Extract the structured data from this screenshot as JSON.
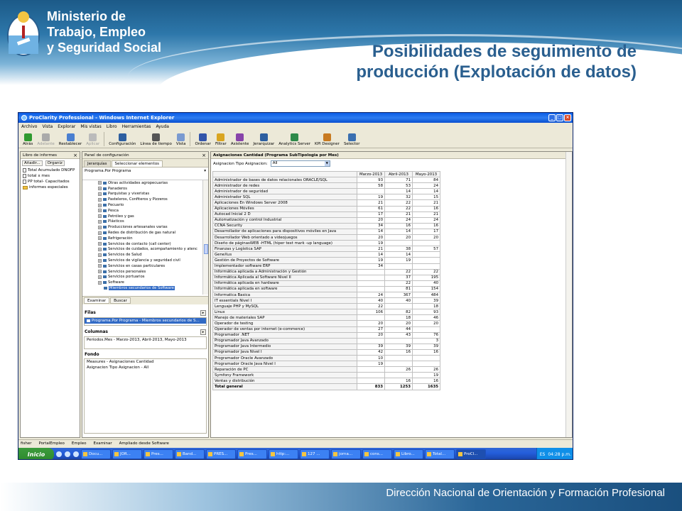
{
  "slide": {
    "ministry_lines": [
      "Ministerio de",
      "Trabajo, Empleo",
      "y Seguridad Social"
    ],
    "title_lines": [
      "Posibilidades de seguimiento de",
      "producción (Explotación de datos)"
    ],
    "footer": "Dirección Nacional de Orientación y Formación Profesional"
  },
  "window": {
    "title": "ProClarity Professional - Windows Internet Explorer",
    "menu": [
      "Archivo",
      "Vista",
      "Explorar",
      "Mis vistas",
      "Libro",
      "Herramientas",
      "Ayuda"
    ],
    "toolbar": [
      {
        "label": "Atrás",
        "icon": "back-icon",
        "color": "#2f9a2f",
        "disabled": false
      },
      {
        "label": "Adelante",
        "icon": "forward-icon",
        "color": "#aaaaaa",
        "disabled": true
      },
      {
        "label": "Restablecer",
        "icon": "reset-icon",
        "color": "#4a7fd0",
        "disabled": false
      },
      {
        "label": "Aplicar",
        "icon": "apply-icon",
        "color": "#bbbbbb",
        "disabled": true
      },
      {
        "label": "Configuración",
        "icon": "layout-icon",
        "color": "#2d5fa0",
        "disabled": false
      },
      {
        "label": "Línea de tiempo",
        "icon": "timeline-icon",
        "color": "#555555",
        "disabled": false
      },
      {
        "label": "Vista",
        "icon": "chart-icon",
        "color": "#7a9ad0",
        "disabled": false
      },
      {
        "label": "Ordenar",
        "icon": "sort-icon",
        "color": "#3355aa",
        "disabled": false
      },
      {
        "label": "Filtrar",
        "icon": "filter-icon",
        "color": "#d9a520",
        "disabled": false
      },
      {
        "label": "Asistente",
        "icon": "wizard-icon",
        "color": "#8844aa",
        "disabled": false
      },
      {
        "label": "Jerarquizar",
        "icon": "hierarchy-icon",
        "color": "#2d5fa0",
        "disabled": false
      },
      {
        "label": "Analytics Server",
        "icon": "server-icon",
        "color": "#2f8a4a",
        "disabled": false
      },
      {
        "label": "KPI Designer",
        "icon": "kpi-icon",
        "color": "#c87a20",
        "disabled": false
      },
      {
        "label": "Selector",
        "icon": "selector-icon",
        "color": "#3a6fb0",
        "disabled": false
      }
    ],
    "libro": {
      "header": "Libro de informes",
      "add_label": "Añadir...",
      "organize_label": "Organiz",
      "items": [
        {
          "label": "Total Acumulado DNOFP",
          "icon": "doc"
        },
        {
          "label": "total x mes",
          "icon": "doc"
        },
        {
          "label": "PP total- Capacitados",
          "icon": "doc"
        },
        {
          "label": "informes especiales",
          "icon": "folder"
        }
      ]
    },
    "config": {
      "header": "Panel de configuración",
      "tabs": [
        "Jerarquías",
        "Seleccionar elementos"
      ],
      "program_label": "Programa.Por Programa",
      "tree": [
        "Otras actividades agropecuarias",
        "Panaderos",
        "Parquistas y viveristas",
        "Pasteleros, Confiteros y Pizzeros",
        "Pecuario",
        "Pesca",
        "Petróleo y gas",
        "Plásticos",
        "Producciones artesanales varias",
        "Redes de distribución de gas natural",
        "Refrigeración",
        "Servicios de contacto (call center)",
        "Servicios de cuidados, acompañamiento y atenc",
        "Servicios de Salud",
        "Servicios de vigilancia y seguridad civil",
        "Servicios en casas particulares",
        "Servicios personales",
        "Servicios portuarios",
        "Software"
      ],
      "tree_selected": "Miembros secundarios de Software",
      "bottom_tabs": [
        "Examinar",
        "Buscar"
      ],
      "filas_label": "Filas",
      "filas_value": "Programa.Por Programa - Miembros secundarios de S...",
      "columnas_label": "Columnas",
      "columnas_value": "Periodos.Mes - Marzo-2013, Abril-2013, Mayo-2013",
      "fondo_label": "Fondo",
      "fondo_values": [
        "Measures - Asignaciones Cantidad",
        "Asignacion Tipo Asignacion - All"
      ]
    },
    "grid": {
      "title": "Asignaciones Cantidad (Programa SubTipologia por Mes)",
      "filter_label": "Asignacion Tipo Asignacion:",
      "filter_value": "All",
      "columns": [
        "Marzo-2013",
        "Abril-2013",
        "Mayo-2013"
      ],
      "rows": [
        [
          "Administrador de bases de datos relacionales ORACLE/SQL",
          "93",
          "71",
          "84"
        ],
        [
          "Administrador de redes",
          "58",
          "53",
          "24"
        ],
        [
          "Administrador de seguridad",
          "",
          "14",
          "14"
        ],
        [
          "Administrador SQL",
          "19",
          "32",
          "15"
        ],
        [
          "Aplicaciones En Windows Server 2008",
          "21",
          "22",
          "21"
        ],
        [
          "Aplicaciones Móviles",
          "61",
          "22",
          "16"
        ],
        [
          "Autocad Inicial 2 D",
          "17",
          "21",
          "21"
        ],
        [
          "Automatización y control Industrial",
          "20",
          "24",
          "24"
        ],
        [
          "CCNA Security",
          "34",
          "16",
          "16"
        ],
        [
          "Desarrollador de aplicaciones para dispositivos móviles en Java",
          "14",
          "14",
          "17"
        ],
        [
          "Desarrollador Web orientado a videojuegos",
          "20",
          "20",
          "20"
        ],
        [
          "Diseño de páginasWEB -HTML (hiper text mark -up language)",
          "19",
          "",
          ""
        ],
        [
          "Finanzas y Logística SAP",
          "21",
          "38",
          "57"
        ],
        [
          "GeneXus",
          "14",
          "14",
          ""
        ],
        [
          "Gestión de Proyectos de Software",
          "19",
          "19",
          ""
        ],
        [
          "Implementador software ERP",
          "34",
          "",
          ""
        ],
        [
          "Informática aplicada a Administración y Gestión",
          "",
          "22",
          "22"
        ],
        [
          "Informática Aplicada al Software Nivel II",
          "",
          "37",
          "195"
        ],
        [
          "Informática aplicada en hardware",
          "",
          "22",
          "40"
        ],
        [
          "Informática aplicada en software",
          "",
          "81",
          "154"
        ],
        [
          "Informatica Basica",
          "24",
          "367",
          "484"
        ],
        [
          "IT essentials Nivel I",
          "40",
          "40",
          "39"
        ],
        [
          "Lenguaje PHP y MySQL",
          "22",
          "",
          "18"
        ],
        [
          "Linux",
          "106",
          "82",
          "93"
        ],
        [
          "Manejo de materiales SAP",
          "",
          "18",
          "46"
        ],
        [
          "Operador de testing",
          "20",
          "20",
          "20"
        ],
        [
          "Operador de ventas por internet (e-commerce)",
          "27",
          "44",
          ""
        ],
        [
          "Programador .NET",
          "20",
          "43",
          "76"
        ],
        [
          "Programador Java Avanzado",
          "",
          "",
          "3"
        ],
        [
          "Programador Java Intermedio",
          "39",
          "39",
          "39"
        ],
        [
          "Programador Java Nivel I",
          "42",
          "16",
          "16"
        ],
        [
          "Programador Oracle Avanzado",
          "10",
          "",
          ""
        ],
        [
          "Programador Oracle Java Nivel I",
          "19",
          "",
          ""
        ],
        [
          "Reparación de PC",
          "",
          "26",
          "26"
        ],
        [
          "Symfony Framework",
          "",
          "",
          "19"
        ],
        [
          "Ventas y distribución",
          "",
          "16",
          "16"
        ]
      ],
      "total": [
        "Total general",
        "833",
        "1253",
        "1635"
      ]
    },
    "statusbar": [
      "fisher",
      "PortalEmpleo",
      "Empleo",
      "Examinar",
      "Ampliado desde Software"
    ],
    "taskbar": {
      "start": "Inicio",
      "tasks": [
        "Docu...",
        "JOR...",
        "Pres...",
        "Band...",
        "PRES...",
        "Pres...",
        "http:...",
        "127 ...",
        "jorna...",
        "cons...",
        "Libro...",
        "Total...",
        "ProCl..."
      ],
      "language": "ES",
      "clock": "04:28 p.m."
    }
  }
}
